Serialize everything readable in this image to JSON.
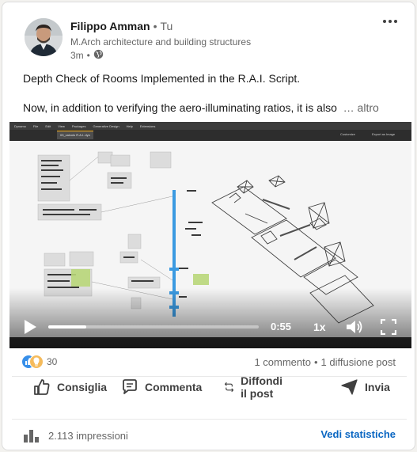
{
  "post": {
    "author": {
      "name": "Filippo Amman",
      "separator": "•",
      "degree": "Tu",
      "headline": "M.Arch architecture and building structures",
      "time": "3m",
      "time_separator": "•",
      "visibility_icon": "globe-icon"
    },
    "text": {
      "line1": "Depth Check of Rooms Implemented in the R.A.I. Script.",
      "line2": "Now, in addition to verifying the aero-illuminating ratios, it is also",
      "see_more": "… altro"
    },
    "video": {
      "timecode": "0:55",
      "speed": "1x",
      "progress_fraction": 0.18,
      "app": {
        "menus": [
          "Dynamo",
          "File",
          "Edit",
          "View",
          "Packages",
          "Generative Design",
          "Help",
          "Extensions"
        ],
        "tab_label": "03_calcolo R.A.I..dyn",
        "tool1": "Customize",
        "tool2": "Export as Image"
      }
    },
    "social": {
      "reaction_count": "30",
      "comments": "1 commento",
      "separator": "•",
      "reposts": "1 diffusione post"
    },
    "actions": {
      "like": "Consiglia",
      "comment": "Commenta",
      "repost": "Diffondi il post",
      "send": "Invia"
    },
    "footer": {
      "impressions": "2.113 impressioni",
      "stats_link": "Vedi statistiche"
    }
  },
  "colors": {
    "link": "#0a66c2",
    "muted_text": "#666666",
    "action_text": "#404040",
    "dynamo_wire": "#3b9ae1",
    "dynamo_group_green": "#b9d77a"
  }
}
